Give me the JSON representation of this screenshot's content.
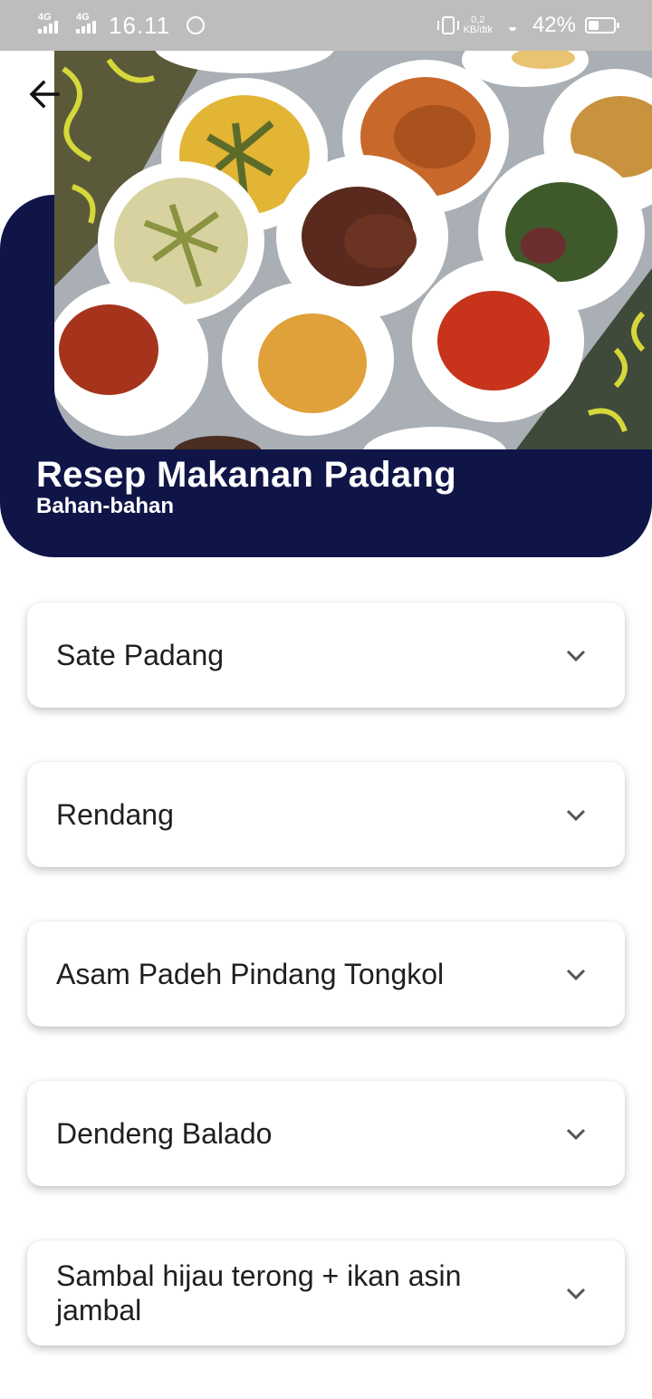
{
  "status_bar": {
    "net1": "4G",
    "net2": "4G",
    "time": "16.11",
    "speed_value": "0,2",
    "speed_unit": "KB/dtk",
    "battery": "42%",
    "icons": [
      "signal-icon",
      "whatsapp-icon",
      "vibrate-icon",
      "wifi-icon",
      "battery-icon"
    ]
  },
  "header": {
    "title": "Resep Makanan Padang",
    "subtitle": "Bahan-bahan",
    "band_color": "#101548"
  },
  "recipes": [
    {
      "label": "Sate Padang"
    },
    {
      "label": "Rendang"
    },
    {
      "label": "Asam Padeh Pindang Tongkol"
    },
    {
      "label": "Dendeng Balado"
    },
    {
      "label": "Sambal hijau terong + ikan asin jambal"
    }
  ]
}
